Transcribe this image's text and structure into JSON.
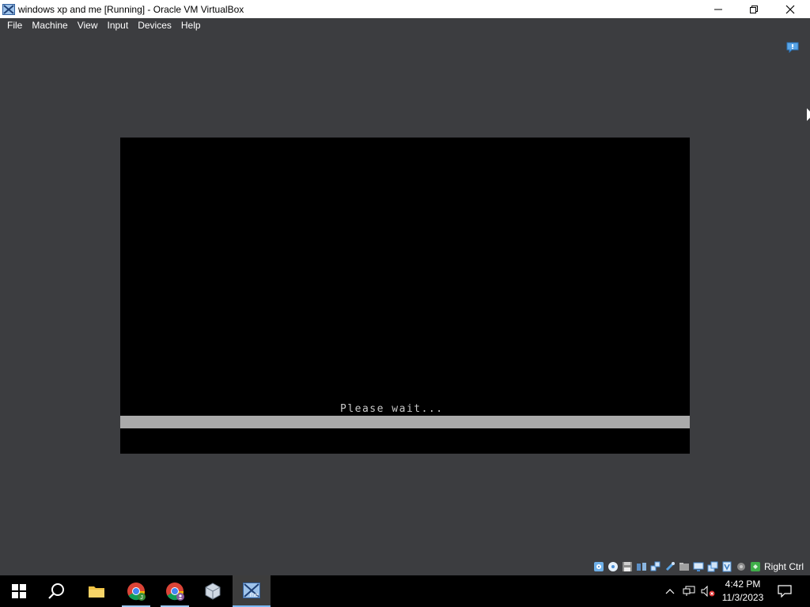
{
  "window": {
    "title": "windows xp and me [Running] - Oracle VM VirtualBox",
    "controls": [
      "minimize",
      "maximize",
      "close"
    ]
  },
  "menubar": {
    "items": [
      {
        "label": "File"
      },
      {
        "label": "Machine"
      },
      {
        "label": "View"
      },
      {
        "label": "Input"
      },
      {
        "label": "Devices"
      },
      {
        "label": "Help"
      }
    ]
  },
  "guest": {
    "status_text": "Please wait...",
    "bar_color": "#aaaaaa"
  },
  "statusbar": {
    "icons": [
      "hard-disk-icon",
      "optical-drive-icon",
      "floppy-icon",
      "audio-icon",
      "network-icon",
      "usb-icon",
      "shared-folders-icon",
      "display-icon",
      "video-capture-icon",
      "recording-icon",
      "cpu-icon",
      "mouse-integration-icon"
    ],
    "host_key": "Right Ctrl"
  },
  "taskbar": {
    "apps": [
      "start-button",
      "search-button",
      "file-explorer",
      "chrome-profile-j",
      "chrome-profile-2",
      "virtualbox-manager",
      "virtualbox-vm-window"
    ],
    "clock": {
      "time": "4:42 PM",
      "date": "11/3/2023"
    }
  },
  "colors": {
    "background": "#3c3d40",
    "taskbar": "#000000",
    "accent": "#7ab8f5"
  }
}
